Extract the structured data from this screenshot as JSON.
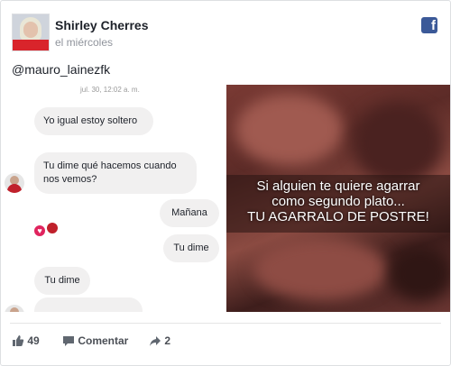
{
  "post": {
    "author": "Shirley Cherres",
    "time": "el miércoles",
    "caption": "@mauro_lainezfk"
  },
  "chat": {
    "timestamp": "jul. 30, 12:02 a. m.",
    "messages": [
      {
        "side": "left",
        "text": "Yo igual estoy soltero"
      },
      {
        "side": "left",
        "text": "Tu dime qué hacemos cuando nos vemos?"
      },
      {
        "side": "right",
        "text": "Mañana"
      },
      {
        "side": "right",
        "text": "Tu dime"
      },
      {
        "side": "left",
        "text": "Tu dime"
      }
    ]
  },
  "image": {
    "line1": "Si alguien te quiere agarrar",
    "line2": "como segundo plato...",
    "line3": "TU AGARRALO DE POSTRE!"
  },
  "actions": {
    "likes": "49",
    "comment_label": "Comentar",
    "shares": "2"
  },
  "icons": [
    "facebook-icon",
    "like-icon",
    "comment-icon",
    "share-icon"
  ],
  "colors": {
    "facebook_blue": "#3b5998",
    "text": "#1d2129",
    "muted": "#90949c"
  }
}
